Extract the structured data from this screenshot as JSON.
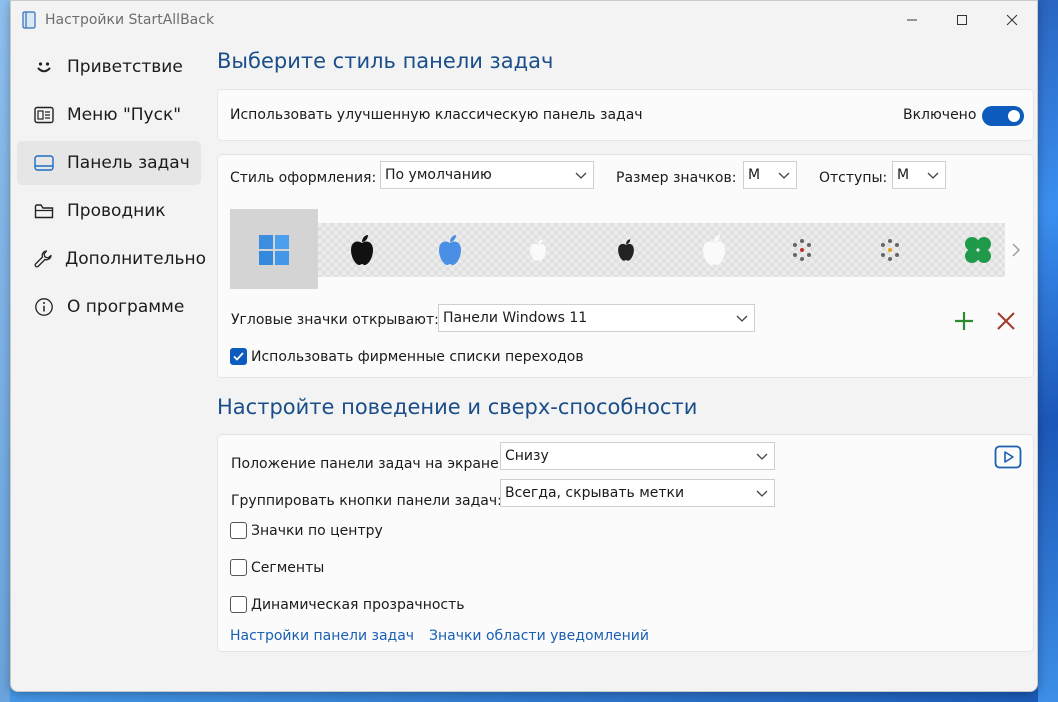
{
  "window": {
    "title": "Настройки StartAllBack"
  },
  "sidebar": {
    "items": [
      {
        "label": "Приветствие",
        "icon": "smiley-icon"
      },
      {
        "label": "Меню \"Пуск\"",
        "icon": "start-menu-icon"
      },
      {
        "label": "Панель задач",
        "icon": "taskbar-icon",
        "active": true
      },
      {
        "label": "Проводник",
        "icon": "folder-icon"
      },
      {
        "label": "Дополнительно",
        "icon": "wrench-icon"
      },
      {
        "label": "О программе",
        "icon": "info-icon"
      }
    ]
  },
  "taskbar_style": {
    "title": "Выберите стиль панели задач",
    "enhanced_label": "Использовать улучшенную классическую панель задач",
    "enhanced_state": "Включено",
    "theme_label": "Стиль оформления:",
    "theme_value": "По умолчанию",
    "icon_size_label": "Размер значков:",
    "icon_size_value": "M",
    "padding_label": "Отступы:",
    "padding_value": "M",
    "start_icons": [
      "windows11-logo-icon",
      "apple-black-icon",
      "apple-blue-icon",
      "apple-white-icon",
      "apple-small-black-icon",
      "apple-white-large-icon",
      "dots-circle-icon",
      "dots-color-icon",
      "clover-green-icon"
    ],
    "corner_label": "Угловые значки открывают:",
    "corner_value": "Панели Windows 11",
    "jumplists_label": "Использовать фирменные списки переходов",
    "jumplists_checked": true
  },
  "behavior": {
    "title": "Настройте поведение и сверх-способности",
    "position_label": "Положение панели задач на экране:",
    "position_value": "Снизу",
    "group_label": "Группировать кнопки панели задач:",
    "group_value": "Всегда, скрывать метки",
    "center_label": "Значки по центру",
    "segments_label": "Сегменты",
    "dynamic_label": "Динамическая прозрачность",
    "link_taskbar": "Настройки панели задач",
    "link_tray": "Значки области уведомлений"
  },
  "colors": {
    "accent": "#0d5bbd",
    "title_blue": "#1a4e8a",
    "link": "#1a5fb4",
    "add_green": "#2e8b2e",
    "remove_red": "#a03a2a"
  }
}
